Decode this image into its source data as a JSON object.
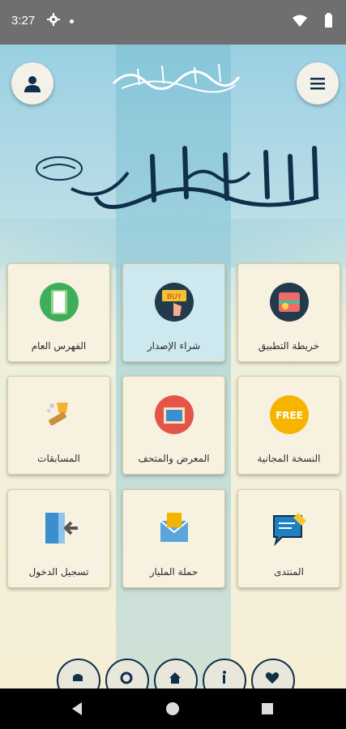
{
  "status": {
    "time": "3:27"
  },
  "header": {
    "logo_text": "السيرة النبوية في ثوبها الجديد",
    "hero_text": "أجمل إنسان في الكون"
  },
  "tiles": [
    {
      "label": "خريطة التطبيق",
      "icon": "map-icon"
    },
    {
      "label": "شراء الإصدار",
      "icon": "buy-icon"
    },
    {
      "label": "الفهرس العام",
      "icon": "book-icon"
    },
    {
      "label": "النسخة المجانية",
      "icon": "free-icon",
      "badge": "FREE"
    },
    {
      "label": "المعرض والمتحف",
      "icon": "gallery-icon"
    },
    {
      "label": "المسابقات",
      "icon": "trophy-icon"
    },
    {
      "label": "المنتدى",
      "icon": "forum-icon"
    },
    {
      "label": "حملة المليار",
      "icon": "mail-icon"
    },
    {
      "label": "تسجيل الدخول",
      "icon": "login-icon"
    }
  ],
  "buy_badge": "BUY",
  "bottom_bar": [
    "alarm-icon",
    "settings-icon",
    "home-icon",
    "info-icon",
    "heart-icon"
  ],
  "colors": {
    "accent": "#0f2f4a",
    "tile_bg": "#f7f2e0",
    "tile_active": "#cde8ef"
  }
}
